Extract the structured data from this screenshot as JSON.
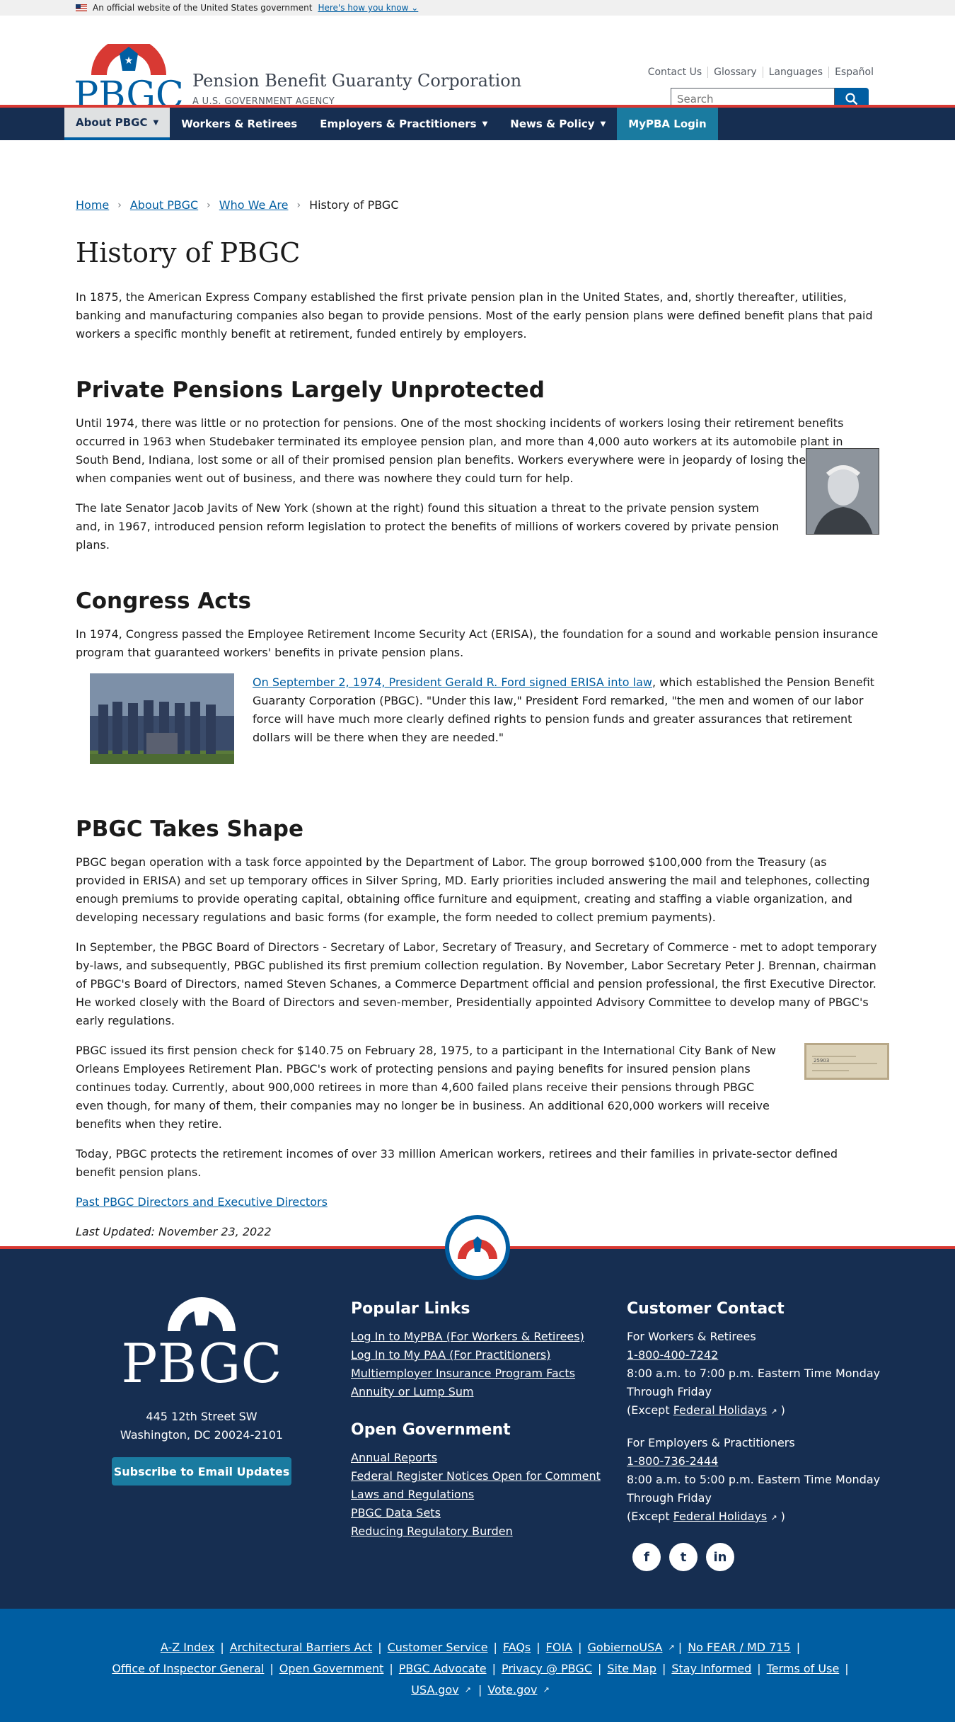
{
  "gov_banner": {
    "text": "An official website of the United States government",
    "link": "Here's how you know"
  },
  "header": {
    "agency_name": "Pension Benefit Guaranty Corporation",
    "agency_sub": "A U.S. GOVERNMENT AGENCY",
    "logo_text": "PBGC",
    "util_links": [
      "Contact Us",
      "Glossary",
      "Languages",
      "Español"
    ],
    "search_placeholder": "Search"
  },
  "nav": {
    "items": [
      {
        "label": "About PBGC",
        "dropdown": true
      },
      {
        "label": "Workers & Retirees",
        "dropdown": false
      },
      {
        "label": "Employers & Practitioners",
        "dropdown": true
      },
      {
        "label": "News & Policy",
        "dropdown": true
      },
      {
        "label": "MyPBA Login",
        "dropdown": false
      }
    ]
  },
  "breadcrumb": [
    "Home",
    "About PBGC",
    "Who We Are",
    "History of PBGC"
  ],
  "page_title": "History of PBGC",
  "intro": "In 1875, the American Express Company established the first private pension plan in the United States, and, shortly thereafter, utilities, banking and manufacturing companies also began to provide pensions. Most of the early pension plans were defined benefit plans that paid workers a specific monthly benefit at retirement, funded entirely by employers.",
  "section1": {
    "title": "Private Pensions Largely Unprotected",
    "p1": "Until 1974, there was little or no protection for pensions. One of the most shocking incidents of workers losing their retirement benefits occurred in 1963 when Studebaker terminated its employee pension plan, and more than 4,000 auto workers at its automobile plant in South Bend, Indiana, lost some or all of their promised pension plan benefits. Workers everywhere were in jeopardy of losing their pensions when companies went out of business, and there was nowhere they could turn for help.",
    "p2": "The late Senator Jacob Javits of New York (shown at the right) found this situation a threat to the private pension system and, in 1967, introduced pension reform legislation to protect the benefits of millions of workers covered by private pension plans."
  },
  "section2": {
    "title": "Congress Acts",
    "p1": "In 1974, Congress passed the Employee Retirement Income Security Act (ERISA), the foundation for a sound and workable pension insurance program that guaranteed workers' benefits in private pension plans.",
    "link": "On September 2, 1974, President Gerald R. Ford signed ERISA into law",
    "p2": ", which established the Pension Benefit Guaranty Corporation (PBGC). \"Under this law,\" President Ford remarked, \"the men and women of our labor force will have much more clearly defined rights to pension funds and greater assurances that retirement dollars will be there when they are needed.\""
  },
  "section3": {
    "title": "PBGC Takes Shape",
    "p1": "PBGC began operation with a task force appointed by the Department of Labor. The group borrowed $100,000 from the Treasury (as provided in ERISA) and set up temporary offices in Silver Spring, MD. Early priorities included answering the mail and telephones, collecting enough premiums to provide operating capital, obtaining office furniture and equipment, creating and staffing a viable organization, and developing necessary regulations and basic forms (for example, the form needed to collect premium payments).",
    "p2": "In September, the PBGC Board of Directors - Secretary of Labor, Secretary of Treasury, and Secretary of Commerce - met to adopt temporary by-laws, and subsequently, PBGC published its first premium collection regulation. By November, Labor Secretary Peter J. Brennan, chairman of PBGC's Board of Directors, named Steven Schanes, a Commerce Department official and pension professional, the first Executive Director. He worked closely with the Board of Directors and seven-member, Presidentially appointed Advisory Committee to develop many of PBGC's early regulations.",
    "p3": "PBGC issued its first pension check for $140.75 on February 28, 1975, to a participant in the International City Bank of New Orleans Employees Retirement Plan. PBGC's work of protecting pensions and paying benefits for insured pension plans continues today. Currently, about 900,000 retirees in more than 4,600 failed plans receive their pensions through PBGC even though, for many of them, their companies may no longer be in business. An additional 620,000 workers will receive benefits when they retire.",
    "p4": "Today, PBGC protects the retirement incomes of over 33 million American workers, retirees and their families in private-sector defined benefit pension plans.",
    "link": "Past PBGC Directors and Executive Directors",
    "updated": "Last Updated: November 23, 2022",
    "check_number": "25903"
  },
  "footer": {
    "logo_text": "PBGC",
    "address1": "445 12th Street SW",
    "address2": "Washington, DC 20024-2101",
    "subscribe": "Subscribe to Email Updates",
    "popular_title": "Popular Links",
    "popular": [
      "Log In to MyPBA (For Workers & Retirees)",
      "Log In to My PAA (For Practitioners)",
      "Multiemployer Insurance Program Facts",
      "Annuity or Lump Sum"
    ],
    "open_title": "Open Government",
    "open": [
      "Annual Reports",
      "Federal Register Notices Open for Comment",
      "Laws and Regulations",
      "PBGC Data Sets",
      "Reducing Regulatory Burden"
    ],
    "contact_title": "Customer Contact",
    "workers_label": "For Workers & Retirees",
    "workers_phone": "1-800-400-7242",
    "workers_hours": "8:00 a.m. to 7:00 p.m. Eastern Time Monday Through Friday",
    "employers_label": "For Employers & Practitioners",
    "employers_phone": "1-800-736-2444",
    "employers_hours": "8:00 a.m. to 5:00 p.m. Eastern Time Monday Through Friday",
    "except_prefix": "(Except",
    "holidays": "Federal Holidays",
    "except_suffix": ")"
  },
  "bottom_links": {
    "row1": [
      "A-Z Index",
      "Architectural Barriers Act",
      "Customer Service",
      "FAQs",
      "FOIA",
      "GobiernoUSA",
      "No FEAR / MD 715"
    ],
    "row2": [
      "Office of Inspector General",
      "Open Government",
      "PBGC Advocate",
      "Privacy @ PBGC",
      "Site Map",
      "Stay Informed",
      "Terms of Use"
    ],
    "row3": [
      "USA.gov",
      "Vote.gov"
    ]
  },
  "colors": {
    "navy": "#162e51",
    "red": "#d83933",
    "blue": "#005ea2",
    "teal": "#1a7ba0"
  }
}
